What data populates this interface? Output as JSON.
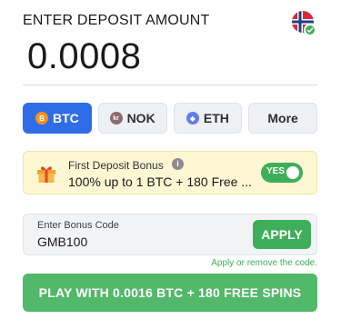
{
  "header": {
    "title": "ENTER DEPOSIT AMOUNT",
    "flag_icon": "norway-flag-icon",
    "verified_icon": "check-badge-icon"
  },
  "amount": {
    "value": "0.0008"
  },
  "currencies": [
    {
      "code": "BTC",
      "icon_letter": "B",
      "icon": "bitcoin-icon",
      "active": true
    },
    {
      "code": "NOK",
      "icon_letter": "kr",
      "icon": "krone-icon",
      "active": false
    },
    {
      "code": "ETH",
      "icon_letter": "◆",
      "icon": "ethereum-icon",
      "active": false
    },
    {
      "code": "More",
      "active": false
    }
  ],
  "bonus": {
    "title": "First Deposit Bonus",
    "description": "100% up to 1 BTC + 180 Free ...",
    "toggle_label": "YES",
    "toggle_on": true,
    "icon": "gift-icon"
  },
  "bonus_code": {
    "label": "Enter Bonus Code",
    "value": "GMB100",
    "apply_label": "APPLY",
    "hint": "Apply or remove the code."
  },
  "cta": {
    "label": "PLAY WITH 0.0016 BTC + 180 FREE SPINS"
  },
  "colors": {
    "primary_blue": "#2f6de8",
    "success_green": "#3fae5a",
    "bonus_bg": "#fdf7d4"
  }
}
